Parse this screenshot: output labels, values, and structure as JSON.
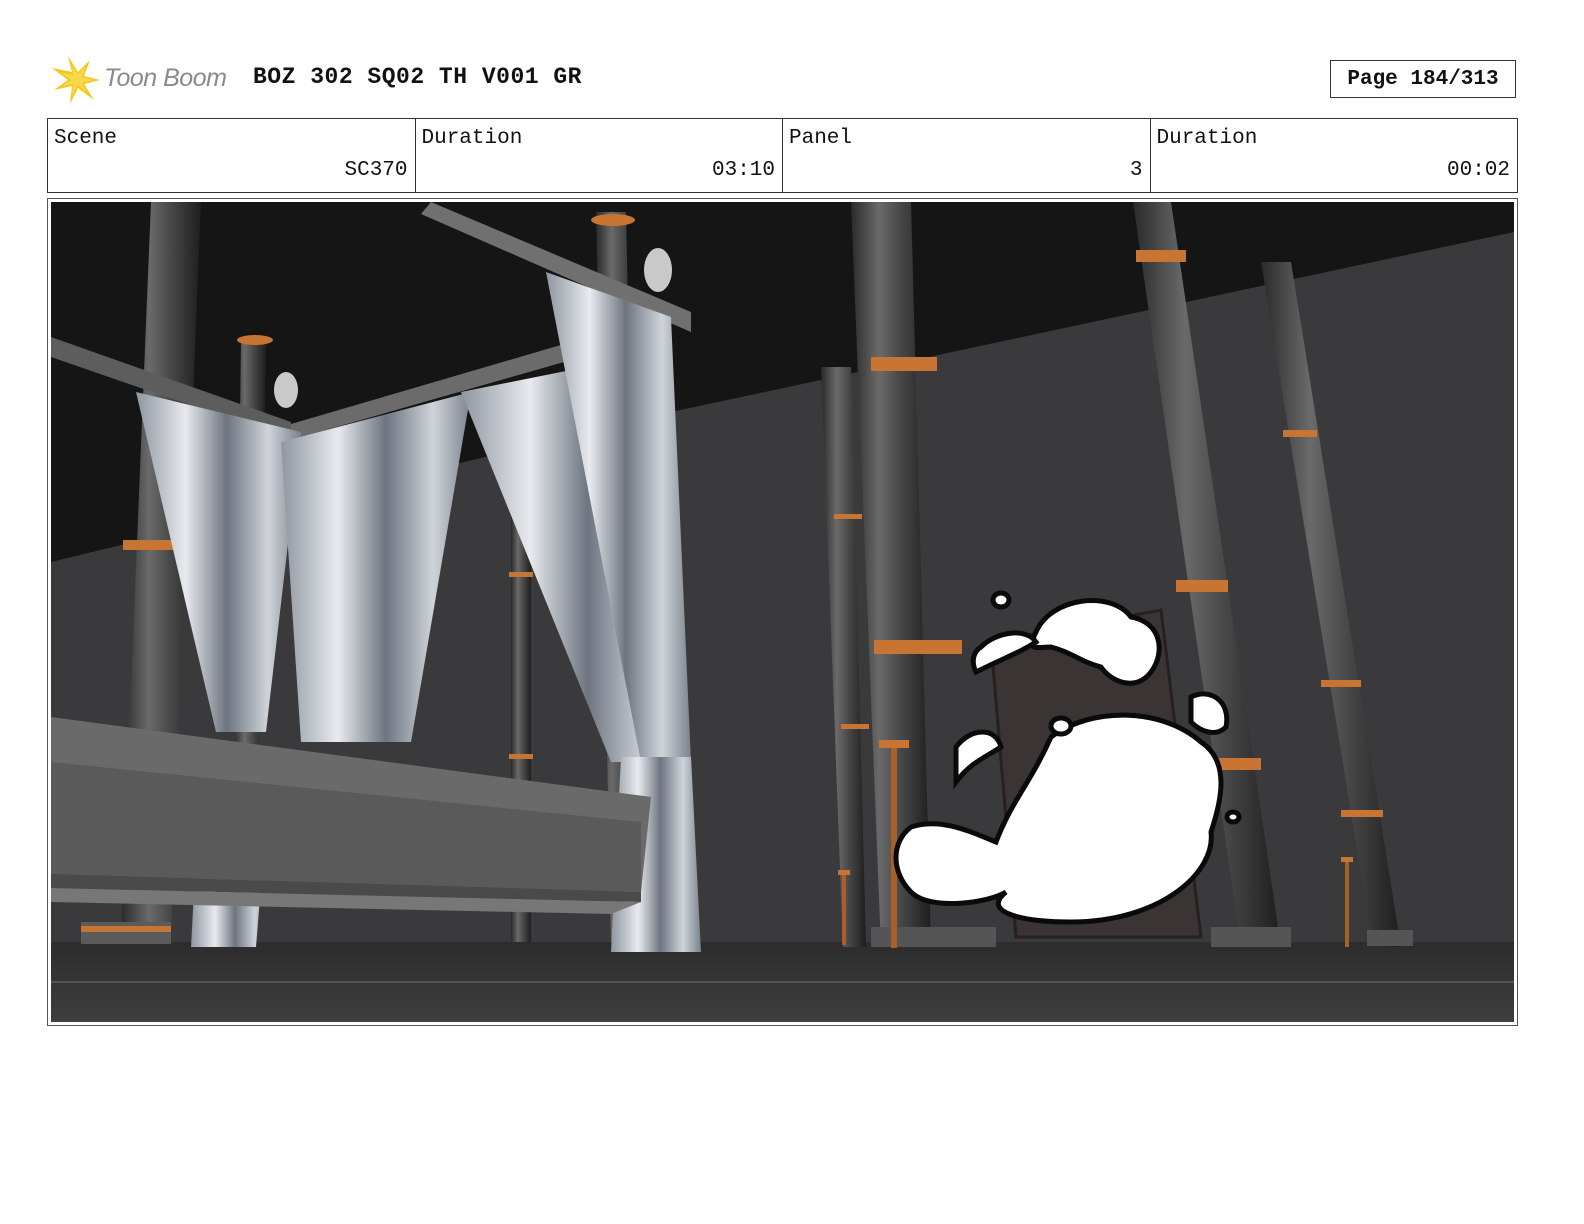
{
  "header": {
    "logo_text": "Toon Boom",
    "title": "BOZ 302 SQ02 TH V001 GR",
    "page": "Page 184/313"
  },
  "info": {
    "scene_label": "Scene",
    "scene_value": "SC370",
    "duration_label": "Duration",
    "duration_value": "03:10",
    "panel_label": "Panel",
    "panel_value": "3",
    "panel_duration_label": "Duration",
    "panel_duration_value": "00:02"
  },
  "colors": {
    "logo_star": "#f5c518",
    "accent_rings": "#c87533",
    "wall": "#3a3a3c",
    "ceiling": "#151515"
  }
}
